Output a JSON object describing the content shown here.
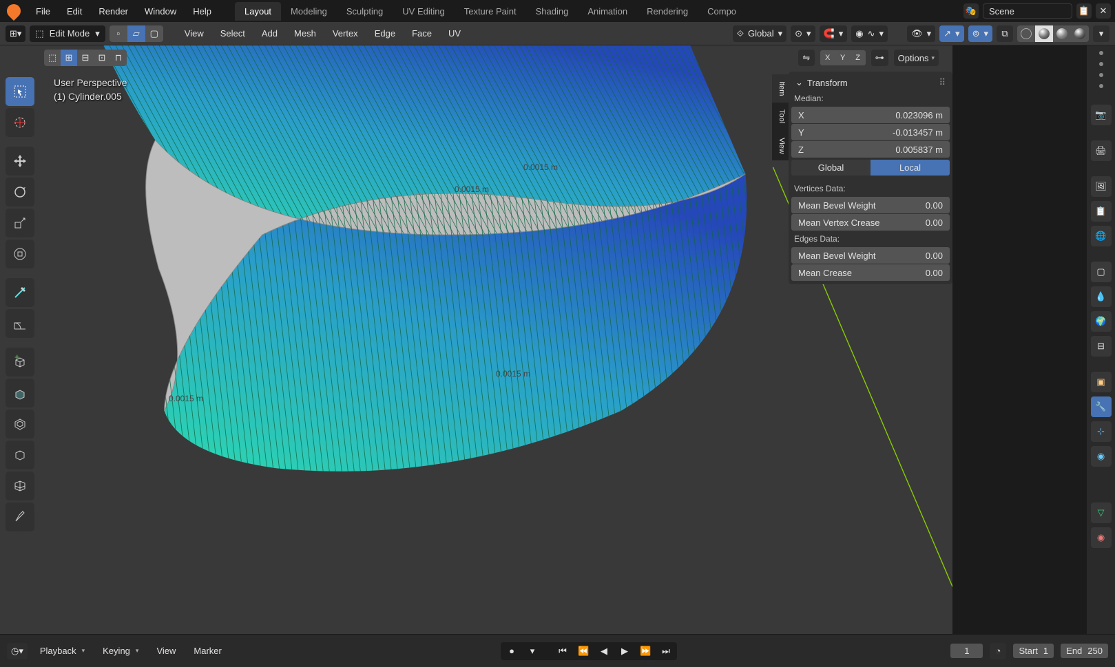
{
  "topbar": {
    "menus": [
      "File",
      "Edit",
      "Render",
      "Window",
      "Help"
    ],
    "tabs": [
      "Layout",
      "Modeling",
      "Sculpting",
      "UV Editing",
      "Texture Paint",
      "Shading",
      "Animation",
      "Rendering",
      "Compo"
    ],
    "active_tab": "Layout",
    "scene_label": "Scene"
  },
  "hdr2": {
    "mode": "Edit Mode",
    "menus": [
      "View",
      "Select",
      "Add",
      "Mesh",
      "Vertex",
      "Edge",
      "Face",
      "UV"
    ],
    "orientation": "Global"
  },
  "viewport": {
    "perspective_line1": "User Perspective",
    "perspective_line2": "(1) Cylinder.005",
    "options_label": "Options",
    "gizmo": {
      "x": "X",
      "y": "Y",
      "z": "Z"
    },
    "edge_labels": [
      "0.0015 m",
      "0.0015 m",
      "0.0015 m",
      "0.0015 m",
      "0.0015 m"
    ]
  },
  "npanel": {
    "title": "Transform",
    "median_label": "Median:",
    "x_label": "X",
    "x_val": "0.023096 m",
    "y_label": "Y",
    "y_val": "-0.013457 m",
    "z_label": "Z",
    "z_val": "0.005837 m",
    "global": "Global",
    "local": "Local",
    "verts_data": "Vertices Data:",
    "mbw": "Mean Bevel Weight",
    "mbw_v": "0.00",
    "mvc": "Mean Vertex Crease",
    "mvc_v": "0.00",
    "edges_data": "Edges Data:",
    "mbw2": "Mean Bevel Weight",
    "mbw2_v": "0.00",
    "mc": "Mean Crease",
    "mc_v": "0.00",
    "side_tabs": [
      "Item",
      "Tool",
      "View"
    ]
  },
  "timeline": {
    "playback": "Playback",
    "keying": "Keying",
    "view": "View",
    "marker": "Marker",
    "frame": "1",
    "start": "Start",
    "start_v": "1",
    "end": "End",
    "end_v": "250"
  }
}
